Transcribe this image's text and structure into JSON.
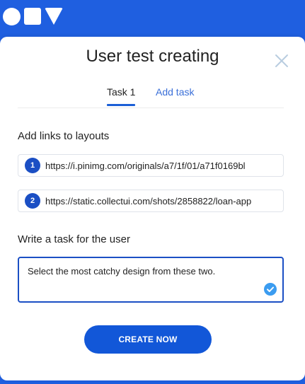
{
  "modal": {
    "title": "User test creating",
    "close_icon": "close-icon"
  },
  "tabs": [
    {
      "label": "Task 1",
      "active": true
    },
    {
      "label": "Add task",
      "active": false
    }
  ],
  "links_section": {
    "label": "Add links to layouts",
    "links": [
      {
        "number": "1",
        "value": "https://i.pinimg.com/originals/a7/1f/01/a71f0169bl"
      },
      {
        "number": "2",
        "value": "https://static.collectui.com/shots/2858822/loan-app"
      }
    ]
  },
  "task_section": {
    "label": "Write a task for the user",
    "value": "Select the most catchy design from these two.",
    "status_icon": "check-circle-icon"
  },
  "actions": {
    "create_label": "CREATE NOW"
  },
  "colors": {
    "brand_blue": "#1f5fe0",
    "accent": "#1257d8",
    "tab_inactive": "#3a6fd8",
    "check": "#3b9cf0"
  },
  "logo_icons": [
    "circle-icon",
    "square-icon",
    "triangle-icon"
  ]
}
